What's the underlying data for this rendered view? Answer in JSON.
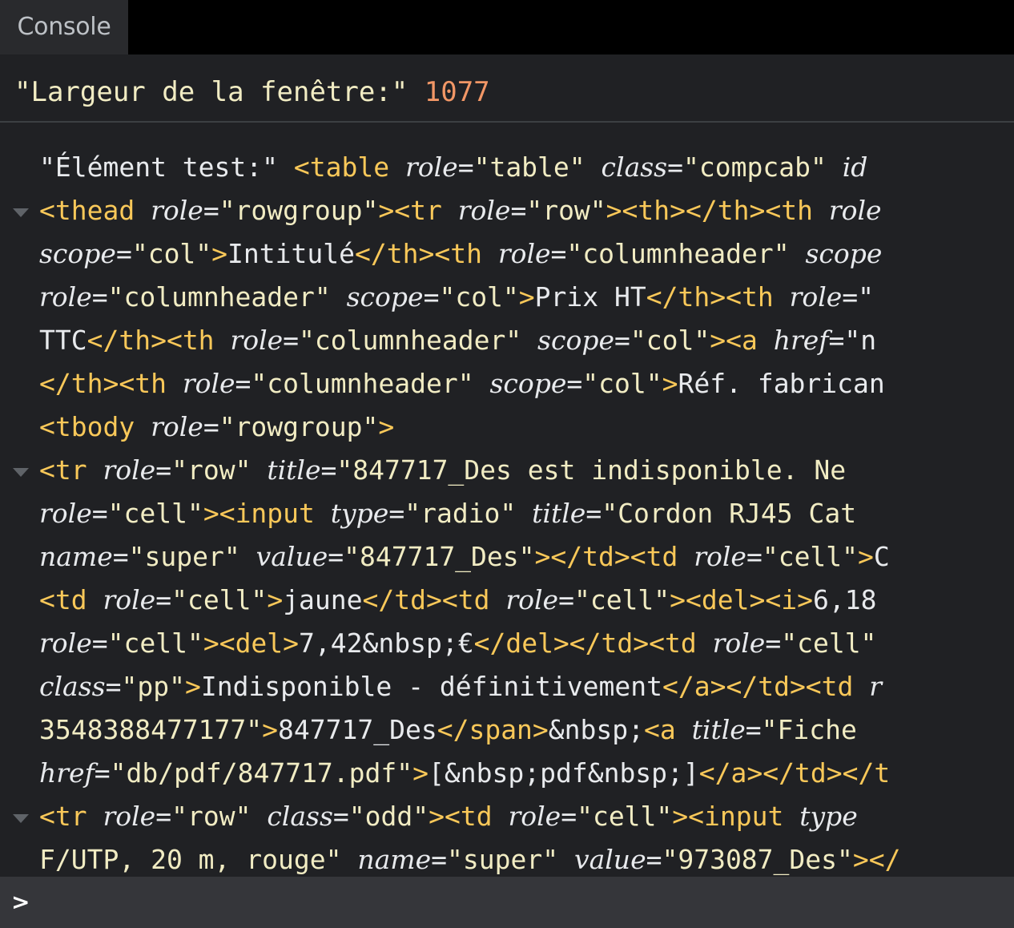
{
  "tab": {
    "label": "Console"
  },
  "messages": [
    {
      "text": "\"Largeur de la fenêtre:\"",
      "value": "1077"
    }
  ],
  "log": {
    "lines": [
      [
        [
          "x",
          "\"Élément test:\" "
        ],
        [
          "t",
          "<table "
        ],
        [
          "a",
          "role"
        ],
        [
          "x",
          "="
        ],
        [
          "v",
          "\"table\" "
        ],
        [
          "a",
          "class"
        ],
        [
          "x",
          "="
        ],
        [
          "v",
          "\"compcab\" "
        ],
        [
          "a",
          "id"
        ]
      ],
      [
        [
          "t",
          "<thead "
        ],
        [
          "a",
          "role"
        ],
        [
          "x",
          "="
        ],
        [
          "v",
          "\"rowgroup\""
        ],
        [
          "t",
          "><tr "
        ],
        [
          "a",
          "role"
        ],
        [
          "x",
          "="
        ],
        [
          "v",
          "\"row\""
        ],
        [
          "t",
          "><th></th><th "
        ],
        [
          "a",
          "role"
        ]
      ],
      [
        [
          "a",
          "scope"
        ],
        [
          "x",
          "="
        ],
        [
          "v",
          "\"col\""
        ],
        [
          "t",
          ">"
        ],
        [
          "x",
          "Intitulé"
        ],
        [
          "t",
          "</th><th "
        ],
        [
          "a",
          "role"
        ],
        [
          "x",
          "="
        ],
        [
          "v",
          "\"columnheader\" "
        ],
        [
          "a",
          "scope"
        ]
      ],
      [
        [
          "a",
          "role"
        ],
        [
          "x",
          "="
        ],
        [
          "v",
          "\"columnheader\" "
        ],
        [
          "a",
          "scope"
        ],
        [
          "x",
          "="
        ],
        [
          "v",
          "\"col\""
        ],
        [
          "t",
          ">"
        ],
        [
          "x",
          "Prix HT"
        ],
        [
          "t",
          "</th><th "
        ],
        [
          "a",
          "role"
        ],
        [
          "x",
          "=\""
        ]
      ],
      [
        [
          "x",
          "TTC"
        ],
        [
          "t",
          "</th><th "
        ],
        [
          "a",
          "role"
        ],
        [
          "x",
          "="
        ],
        [
          "v",
          "\"columnheader\" "
        ],
        [
          "a",
          "scope"
        ],
        [
          "x",
          "="
        ],
        [
          "v",
          "\"col\""
        ],
        [
          "t",
          "><a "
        ],
        [
          "a",
          "href"
        ],
        [
          "x",
          "=\"n"
        ]
      ],
      [
        [
          "t",
          "</th><th "
        ],
        [
          "a",
          "role"
        ],
        [
          "x",
          "="
        ],
        [
          "v",
          "\"columnheader\" "
        ],
        [
          "a",
          "scope"
        ],
        [
          "x",
          "="
        ],
        [
          "v",
          "\"col\""
        ],
        [
          "t",
          ">"
        ],
        [
          "x",
          "Réf. fabrican"
        ]
      ],
      [
        [
          "t",
          "<tbody "
        ],
        [
          "a",
          "role"
        ],
        [
          "x",
          "="
        ],
        [
          "v",
          "\"rowgroup\""
        ],
        [
          "t",
          ">"
        ]
      ],
      [
        [
          "t",
          "<tr "
        ],
        [
          "a",
          "role"
        ],
        [
          "x",
          "="
        ],
        [
          "v",
          "\"row\" "
        ],
        [
          "a",
          "title"
        ],
        [
          "x",
          "="
        ],
        [
          "v",
          "\"847717_Des est indisponible. Ne"
        ]
      ],
      [
        [
          "a",
          "role"
        ],
        [
          "x",
          "="
        ],
        [
          "v",
          "\"cell\""
        ],
        [
          "t",
          "><input "
        ],
        [
          "a",
          "type"
        ],
        [
          "x",
          "="
        ],
        [
          "v",
          "\"radio\" "
        ],
        [
          "a",
          "title"
        ],
        [
          "x",
          "="
        ],
        [
          "v",
          "\"Cordon RJ45 Cat"
        ]
      ],
      [
        [
          "a",
          "name"
        ],
        [
          "x",
          "="
        ],
        [
          "v",
          "\"super\" "
        ],
        [
          "a",
          "value"
        ],
        [
          "x",
          "="
        ],
        [
          "v",
          "\"847717_Des\""
        ],
        [
          "t",
          "></td><td "
        ],
        [
          "a",
          "role"
        ],
        [
          "x",
          "="
        ],
        [
          "v",
          "\"cell\""
        ],
        [
          "t",
          ">"
        ],
        [
          "x",
          "C"
        ]
      ],
      [
        [
          "t",
          "<td "
        ],
        [
          "a",
          "role"
        ],
        [
          "x",
          "="
        ],
        [
          "v",
          "\"cell\""
        ],
        [
          "t",
          ">"
        ],
        [
          "x",
          "jaune"
        ],
        [
          "t",
          "</td><td "
        ],
        [
          "a",
          "role"
        ],
        [
          "x",
          "="
        ],
        [
          "v",
          "\"cell\""
        ],
        [
          "t",
          "><del><i>"
        ],
        [
          "x",
          "6,18"
        ]
      ],
      [
        [
          "a",
          "role"
        ],
        [
          "x",
          "="
        ],
        [
          "v",
          "\"cell\""
        ],
        [
          "t",
          "><del>"
        ],
        [
          "x",
          "7,42&nbsp;€"
        ],
        [
          "t",
          "</del></td><td "
        ],
        [
          "a",
          "role"
        ],
        [
          "x",
          "="
        ],
        [
          "v",
          "\"cell\""
        ]
      ],
      [
        [
          "a",
          "class"
        ],
        [
          "x",
          "="
        ],
        [
          "v",
          "\"pp\""
        ],
        [
          "t",
          ">"
        ],
        [
          "x",
          "Indisponible - définitivement"
        ],
        [
          "t",
          "</a></td><td "
        ],
        [
          "a",
          "r"
        ]
      ],
      [
        [
          "v",
          "3548388477177\""
        ],
        [
          "t",
          ">"
        ],
        [
          "x",
          "847717_Des"
        ],
        [
          "t",
          "</span>"
        ],
        [
          "x",
          "&nbsp;"
        ],
        [
          "t",
          "<a "
        ],
        [
          "a",
          "title"
        ],
        [
          "x",
          "="
        ],
        [
          "v",
          "\"Fiche "
        ]
      ],
      [
        [
          "a",
          "href"
        ],
        [
          "x",
          "="
        ],
        [
          "v",
          "\"db/pdf/847717.pdf\""
        ],
        [
          "t",
          ">"
        ],
        [
          "x",
          "[&nbsp;pdf&nbsp;]"
        ],
        [
          "t",
          "</a></td></t"
        ]
      ],
      [
        [
          "t",
          "<tr "
        ],
        [
          "a",
          "role"
        ],
        [
          "x",
          "="
        ],
        [
          "v",
          "\"row\" "
        ],
        [
          "a",
          "class"
        ],
        [
          "x",
          "="
        ],
        [
          "v",
          "\"odd\""
        ],
        [
          "t",
          "><td "
        ],
        [
          "a",
          "role"
        ],
        [
          "x",
          "="
        ],
        [
          "v",
          "\"cell\""
        ],
        [
          "t",
          "><input "
        ],
        [
          "a",
          "type"
        ]
      ],
      [
        [
          "v",
          "F/UTP, 20 m, rouge\" "
        ],
        [
          "a",
          "name"
        ],
        [
          "x",
          "="
        ],
        [
          "v",
          "\"super\" "
        ],
        [
          "a",
          "value"
        ],
        [
          "x",
          "="
        ],
        [
          "v",
          "\"973087_Des\""
        ],
        [
          "t",
          "></"
        ]
      ]
    ],
    "expand_lines": [
      1,
      7,
      15
    ]
  },
  "prompt": {
    "symbol": ">"
  },
  "colors": {
    "background": "#202124",
    "tag": "#f9c859",
    "attr_value": "#f1ecc3",
    "number": "#f29766",
    "text": "#e8eaed"
  }
}
